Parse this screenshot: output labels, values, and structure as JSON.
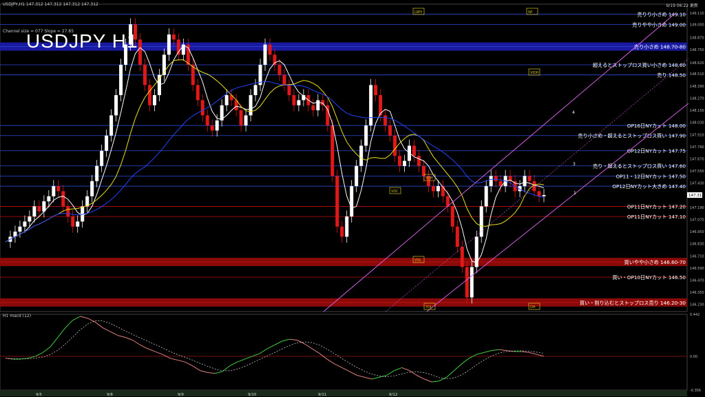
{
  "header": {
    "symbol_line": "USDJPY,H1 147.312 147.312 147.312 147.312",
    "channel_info": "Channel size = 077 Slope = 27.85",
    "timestamp": "9/19 06:22 更新",
    "big_title": "USDJPY H1",
    "macd_label": "H1 macd (12)"
  },
  "chart_data": {
    "type": "candlestick",
    "title": "USDJPY H1",
    "ylim": [
      146.16,
      149.2
    ],
    "y_ticks": [
      "149.210",
      "149.110",
      "149.000",
      "148.870",
      "148.750",
      "148.620",
      "148.510",
      "148.390",
      "148.270",
      "148.150",
      "148.030",
      "147.910",
      "147.790",
      "147.670",
      "147.550",
      "147.430",
      "147.312",
      "147.190",
      "147.070",
      "146.950",
      "146.830",
      "146.710",
      "146.590",
      "146.470",
      "146.350",
      "146.230"
    ],
    "current_price": "147.312",
    "x_dates": [
      "9/5",
      "9/8",
      "9/9",
      "9/10",
      "9/11",
      "9/12"
    ],
    "close_path": [
      146.85,
      146.9,
      146.95,
      147.0,
      147.05,
      147.1,
      147.2,
      147.15,
      147.25,
      147.3,
      147.4,
      147.35,
      147.2,
      147.1,
      147.0,
      147.05,
      147.2,
      147.3,
      147.45,
      147.6,
      147.75,
      147.9,
      148.1,
      148.3,
      148.6,
      148.8,
      149.0,
      148.85,
      148.6,
      148.4,
      148.2,
      148.3,
      148.5,
      148.7,
      148.9,
      148.85,
      148.7,
      148.8,
      148.6,
      148.4,
      148.25,
      148.1,
      148.0,
      147.95,
      148.05,
      148.2,
      148.3,
      148.25,
      148.15,
      148.0,
      148.1,
      148.3,
      148.4,
      148.6,
      148.8,
      148.7,
      148.6,
      148.5,
      148.4,
      148.3,
      148.2,
      148.25,
      148.3,
      148.2,
      148.15,
      148.25,
      148.2,
      148.0,
      147.5,
      147.0,
      146.9,
      147.1,
      147.4,
      147.6,
      147.8,
      148.0,
      148.4,
      148.3,
      148.1,
      148.0,
      147.9,
      147.7,
      147.6,
      147.65,
      147.8,
      147.7,
      147.6,
      147.5,
      147.4,
      147.35,
      147.4,
      147.3,
      147.2,
      147.0,
      146.8,
      146.6,
      146.3,
      146.6,
      146.9,
      147.2,
      147.4,
      147.5,
      147.45,
      147.4,
      147.5,
      147.45,
      147.35,
      147.4,
      147.5,
      147.45,
      147.35,
      147.3,
      147.312
    ],
    "macd_ylim": [
      -0.356,
      0.442
    ],
    "macd_ticks": [
      "0.442",
      "0.00",
      "-0.356"
    ],
    "macd_path": [
      -0.02,
      -0.03,
      -0.03,
      -0.02,
      0.0,
      0.04,
      0.1,
      0.2,
      0.3,
      0.38,
      0.42,
      0.4,
      0.36,
      0.3,
      0.26,
      0.22,
      0.2,
      0.17,
      0.12,
      0.08,
      0.05,
      0.02,
      -0.02,
      -0.04,
      -0.06,
      -0.1,
      -0.15,
      -0.17,
      -0.18,
      -0.16,
      -0.1,
      -0.06,
      -0.03,
      0.0,
      0.03,
      0.08,
      0.12,
      0.16,
      0.18,
      0.17,
      0.13,
      0.08,
      0.03,
      -0.03,
      -0.08,
      -0.12,
      -0.16,
      -0.2,
      -0.22,
      -0.24,
      -0.22,
      -0.2,
      -0.15,
      -0.12,
      -0.15,
      -0.2,
      -0.24,
      -0.27,
      -0.26,
      -0.22,
      -0.15,
      -0.08,
      -0.02,
      0.02,
      0.04,
      0.06,
      0.07,
      0.06,
      0.05,
      0.05,
      0.04,
      0.02,
      0.0
    ],
    "levels": [
      {
        "price": 149.1,
        "label": "売りり小さめ 149.10",
        "color": "#2c4bd8",
        "band": false
      },
      {
        "price": 149.0,
        "label": "売りやや小さめ 149.00",
        "color": "#2c4bd8",
        "band": false
      },
      {
        "price": 148.78,
        "label": "売り小さめ 148.70-80",
        "color": "#2c4bd8",
        "band": true,
        "bandColor": "#1a1aa0"
      },
      {
        "price": 148.6,
        "label": "超えるとストップロス買い小さめ 148.60",
        "color": "#2c4bd8",
        "band": false
      },
      {
        "price": 148.5,
        "label": "売り 148.50",
        "color": "#2c4bd8",
        "band": false
      },
      {
        "price": 148.0,
        "label": "OP16日NYカット 148.00",
        "color": "#2c4bd8",
        "band": false
      },
      {
        "price": 147.9,
        "label": "売り小さめ・超えるとストップロス買い 147.90",
        "color": "#2c4bd8",
        "band": false
      },
      {
        "price": 147.75,
        "label": "OP12日NYカット 147.75",
        "color": "#2c4bd8",
        "band": false
      },
      {
        "price": 147.6,
        "label": "売り・超えるとストップロス買い 147.60",
        "color": "#2c4bd8",
        "band": false
      },
      {
        "price": 147.5,
        "label": "OP11・12日NYカット 147.50",
        "color": "#2c4bd8",
        "band": false
      },
      {
        "price": 147.4,
        "label": "OP12日NYカット大きめ 147.40",
        "color": "#2c4bd8",
        "band": false
      },
      {
        "price": 147.2,
        "label": "OP11日NYカット 147.20",
        "color": "#c01010",
        "band": false
      },
      {
        "price": 147.1,
        "label": "OP11日NYカット 147.10",
        "color": "#c01010",
        "band": false
      },
      {
        "price": 146.65,
        "label": "買いやや小さめ 146.60-70",
        "color": "#c01010",
        "band": true,
        "bandColor": "#8a0a0a"
      },
      {
        "price": 146.5,
        "label": "買い・OP10日NYカット 146.50",
        "color": "#c01010",
        "band": false
      },
      {
        "price": 146.25,
        "label": "買い・割り込むとストップロス売り 146.20-30",
        "color": "#c01010",
        "band": true,
        "bandColor": "#8a0a0a"
      }
    ],
    "box_labels": [
      "LWH",
      "WI",
      "VIDH",
      "VDC",
      "VDL",
      "YDL",
      "YDH",
      "DH"
    ],
    "channel_points": [
      "1",
      "3",
      "4"
    ],
    "colors": {
      "up": "#ffffff",
      "down": "#e01818",
      "ma_white": "#ffffff",
      "ma_yellow": "#e8e020",
      "ma_blue": "#2244ff",
      "channel": "#d060e0",
      "macd": "#e08080",
      "signal": "#dddddd"
    }
  }
}
